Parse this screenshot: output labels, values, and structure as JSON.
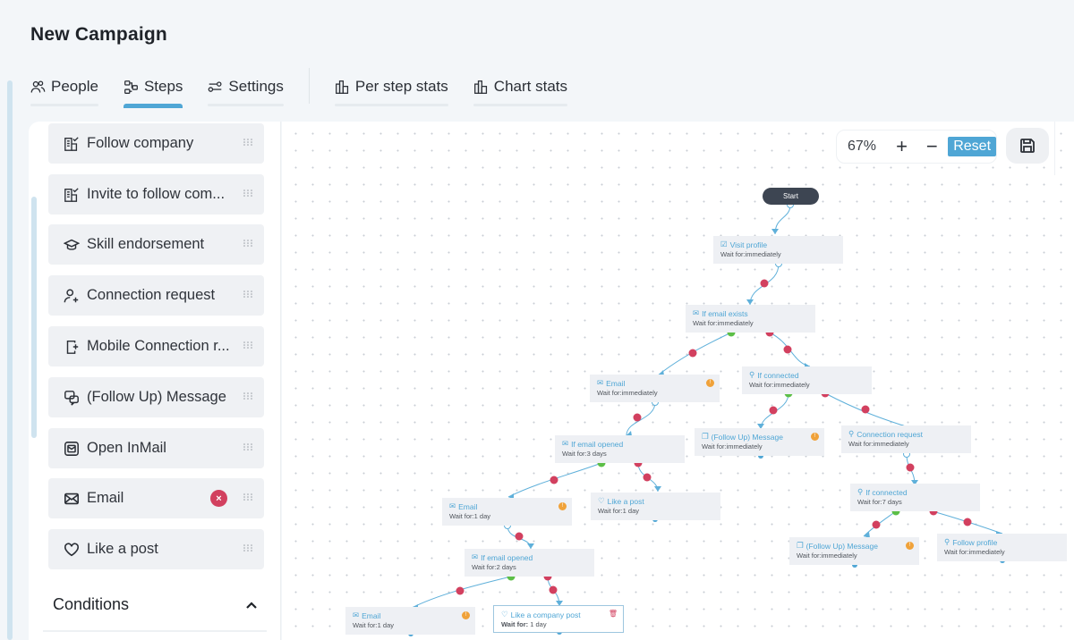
{
  "header": {
    "title": "New Campaign"
  },
  "tabs": [
    {
      "label": "People",
      "icon": "people-icon",
      "active": false
    },
    {
      "label": "Steps",
      "icon": "steps-icon",
      "active": true
    },
    {
      "label": "Settings",
      "icon": "settings-icon",
      "active": false
    },
    {
      "label": "Per step stats",
      "icon": "bar-chart-icon",
      "active": false
    },
    {
      "label": "Chart stats",
      "icon": "bar-chart-icon",
      "active": false
    }
  ],
  "steps_panel": {
    "items": [
      {
        "label": "Follow company",
        "icon": "building-check-icon"
      },
      {
        "label": "Invite to follow com...",
        "icon": "building-check-icon"
      },
      {
        "label": "Skill endorsement",
        "icon": "graduation-cap-icon"
      },
      {
        "label": "Connection request",
        "icon": "user-plus-icon"
      },
      {
        "label": "Mobile Connection r...",
        "icon": "mobile-add-icon"
      },
      {
        "label": "(Follow Up) Message",
        "icon": "chat-icon"
      },
      {
        "label": "Open InMail",
        "icon": "inmail-icon"
      },
      {
        "label": "Email",
        "icon": "envelope-icon",
        "error_badge": "×"
      },
      {
        "label": "Like a post",
        "icon": "heart-icon"
      }
    ],
    "conditions_label": "Conditions"
  },
  "canvas": {
    "zoom_level": "67%",
    "zoom_in_label": "+",
    "zoom_out_label": "−",
    "reset_label": "Reset",
    "save_icon": "save-icon",
    "colors": {
      "accent": "#4fa6d5",
      "no_branch": "#d2405f",
      "yes_branch": "#5cbf47",
      "warning": "#f0a23a",
      "start": "#3d4552"
    },
    "start_label": "Start",
    "nodes": [
      {
        "id": "visit",
        "title": "Visit profile",
        "wait": "Wait for:immediately",
        "icon": "visit-icon"
      },
      {
        "id": "ifemail",
        "title": "If email exists",
        "wait": "Wait for:immediately",
        "icon": "email-check-icon"
      },
      {
        "id": "email1",
        "title": "Email",
        "wait": "Wait for:immediately",
        "icon": "envelope-icon",
        "warning": true
      },
      {
        "id": "ifconn1",
        "title": "If connected",
        "wait": "Wait for:immediately",
        "icon": "user-icon"
      },
      {
        "id": "ifopen1",
        "title": "If email opened",
        "wait": "Wait for:3 days",
        "icon": "email-open-icon"
      },
      {
        "id": "fumsg1",
        "title": "(Follow Up) Message",
        "wait": "Wait for:immediately",
        "icon": "chat-icon",
        "warning": true
      },
      {
        "id": "connreq",
        "title": "Connection request",
        "wait": "Wait for:immediately",
        "icon": "user-plus-icon"
      },
      {
        "id": "likepost",
        "title": "Like a post",
        "wait": "Wait for:1 day",
        "icon": "heart-icon"
      },
      {
        "id": "email2",
        "title": "Email",
        "wait": "Wait for:1 day",
        "icon": "envelope-icon",
        "warning": true
      },
      {
        "id": "ifconn2",
        "title": "If connected",
        "wait": "Wait for:7 days",
        "icon": "user-icon"
      },
      {
        "id": "ifopen2",
        "title": "If email opened",
        "wait": "Wait for:2 days",
        "icon": "email-open-icon"
      },
      {
        "id": "fumsg2",
        "title": "(Follow Up) Message",
        "wait": "Wait for:immediately",
        "icon": "chat-icon",
        "warning": true
      },
      {
        "id": "followprof",
        "title": "Follow profile",
        "wait": "Wait for:immediately",
        "icon": "user-follow-icon"
      },
      {
        "id": "email3",
        "title": "Email",
        "wait": "Wait for:1 day",
        "icon": "envelope-icon",
        "warning": true
      },
      {
        "id": "likecomp",
        "title": "Like a company post",
        "wait_label": "Wait for:",
        "wait_value": " 1 day",
        "icon": "heart-icon",
        "selected": true
      }
    ]
  }
}
